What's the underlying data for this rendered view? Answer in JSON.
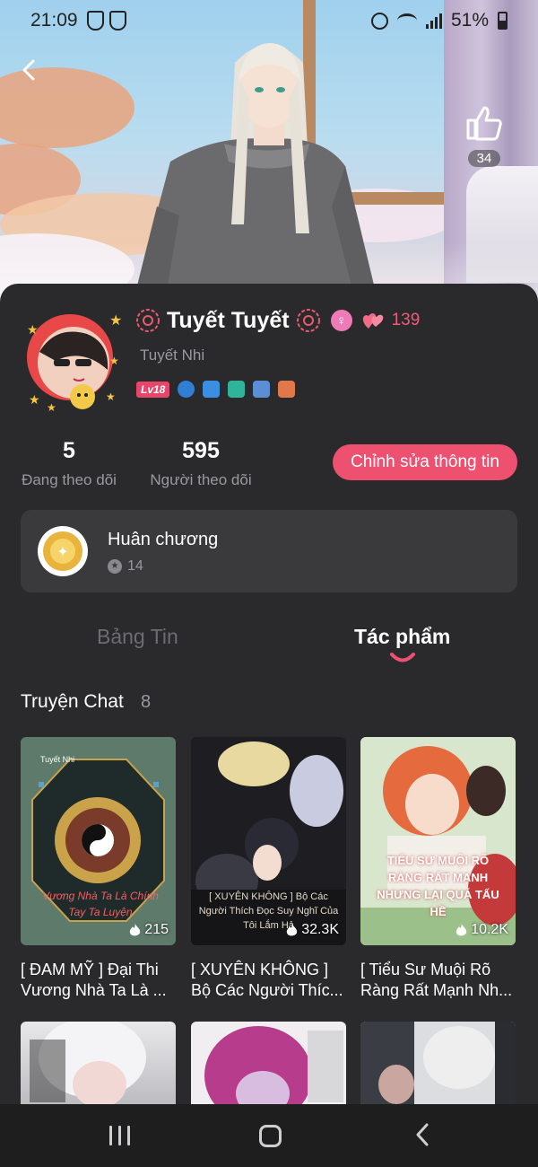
{
  "status_bar": {
    "time": "21:09",
    "battery": "51%"
  },
  "header": {
    "like_count": "34"
  },
  "profile": {
    "name": "Tuyết Tuyết",
    "female_symbol": "♀",
    "heart_count": "139",
    "username": "Tuyết Nhi",
    "level": "Lv18",
    "following_count": "5",
    "following_label": "Đang theo dõi",
    "followers_count": "595",
    "followers_label": "Người theo dõi",
    "edit_button_label": "Chỉnh sửa thông tin"
  },
  "medals": {
    "title": "Huân chương",
    "count": "14"
  },
  "tabs": [
    {
      "label": "Bảng Tin",
      "active": false
    },
    {
      "label": "Tác phẩm",
      "active": true
    }
  ],
  "section": {
    "title": "Truyện Chat",
    "count": "8"
  },
  "works": [
    {
      "title": "[ ĐAM MỸ ] Đại Thi Vương Nhà Ta Là ...",
      "views": "215",
      "cover_text": "Vương Nhà Ta Là Chính Tay Ta Luyện",
      "author_tag": "Tuyết Nhi"
    },
    {
      "title": "[ XUYÊN KHÔNG ] Bộ Các Người Thíc...",
      "views": "32.3K",
      "cover_text": "[ XUYÊN KHÔNG ] Bộ Các Người Thích Đọc Suy Nghĩ Của Tôi Lắm Hả"
    },
    {
      "title": "[ Tiểu Sư Muội Rõ Ràng Rất Mạnh Nh...",
      "views": "10.2K",
      "cover_text": "TIỂU SƯ MUỘI RÕ RÀNG RẤT MẠNH NHƯNG LẠI QUÁ TẤU HỀ"
    }
  ],
  "colors": {
    "accent": "#ee5170",
    "background": "#2a2a2c",
    "card": "#3a3a3d",
    "muted_text": "#9a9a9e"
  }
}
